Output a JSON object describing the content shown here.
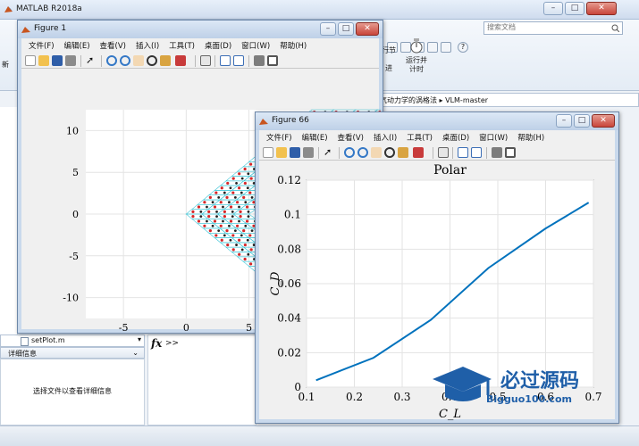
{
  "matlab": {
    "title": "MATLAB R2018a",
    "search_placeholder": "搜索文档",
    "toolstrip": {
      "run_section_label": "行节",
      "advance_label": "进",
      "run_and_time_label1": "运行并",
      "run_and_time_label2": "计时"
    },
    "path": "气动力学的涡格法 ▸ VLM-master",
    "current_file": "setPlot.m",
    "details_header": "详细信息",
    "details_hint": "选择文件以查看详细信息",
    "cmd_prompt": "fx",
    "cmd_arrows": ">>"
  },
  "menus": [
    "文件(F)",
    "编辑(E)",
    "查看(V)",
    "插入(I)",
    "工具(T)",
    "桌面(D)",
    "窗口(W)",
    "帮助(H)"
  ],
  "figure1": {
    "title": "Figure 1",
    "chart_data": {
      "type": "scatter",
      "title": "",
      "xlabel": "",
      "ylabel": "",
      "xlim": [
        -8,
        15
      ],
      "ylim": [
        -12.5,
        12.5
      ],
      "xticks": [
        "-5",
        "0",
        "5",
        "10"
      ],
      "yticks": [
        "10",
        "5",
        "0",
        "-5",
        "-10"
      ],
      "grid": true,
      "description_of_geometry": "swept wing vortex-lattice mesh",
      "colors": {
        "mesh_red": "#d62728",
        "mesh_black": "#222222",
        "mesh_cyan": "#3fc6d8"
      }
    }
  },
  "figure66": {
    "title": "Figure 66",
    "chart_data": {
      "type": "line",
      "title": "Polar",
      "xlabel": "C_L",
      "ylabel": "C_D",
      "xlim": [
        0.1,
        0.7
      ],
      "ylim": [
        0,
        0.12
      ],
      "xticks": [
        "0.1",
        "0.2",
        "0.3",
        "0.4",
        "0.5",
        "0.6",
        "0.7"
      ],
      "yticks": [
        "0",
        "0.02",
        "0.04",
        "0.06",
        "0.08",
        "0.1",
        "0.12"
      ],
      "grid": true,
      "series": [
        {
          "name": "",
          "color": "#0072bd",
          "x": [
            0.12,
            0.24,
            0.36,
            0.48,
            0.6,
            0.69
          ],
          "y": [
            0.004,
            0.017,
            0.039,
            0.069,
            0.092,
            0.107
          ]
        }
      ]
    }
  },
  "watermark": {
    "line1": "必过源码",
    "line2": "Bigguo100.com"
  }
}
